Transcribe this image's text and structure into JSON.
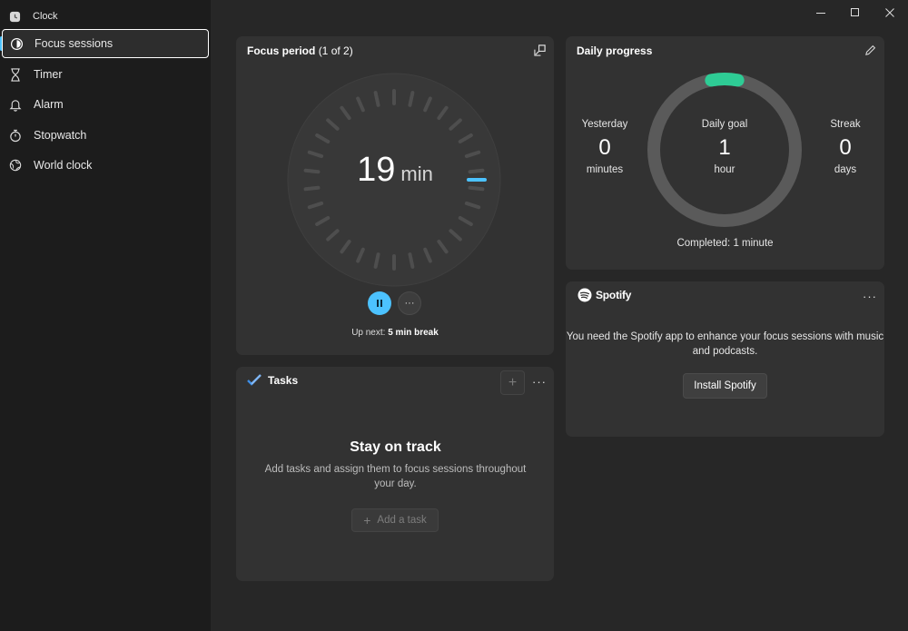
{
  "app": {
    "title": "Clock"
  },
  "sidebar": {
    "items": [
      {
        "label": "Focus sessions",
        "icon": "focus-icon",
        "active": true
      },
      {
        "label": "Timer",
        "icon": "hourglass-icon"
      },
      {
        "label": "Alarm",
        "icon": "bell-icon"
      },
      {
        "label": "Stopwatch",
        "icon": "stopwatch-icon"
      },
      {
        "label": "World clock",
        "icon": "globe-icon"
      }
    ]
  },
  "focus": {
    "title": "Focus period",
    "subtitle": "(1 of 2)",
    "time_value": "19",
    "time_unit": "min",
    "up_next_prefix": "Up next:",
    "up_next_value": "5 min break"
  },
  "tasks": {
    "title": "Tasks",
    "heading": "Stay on track",
    "description": "Add tasks and assign them to focus sessions throughout your day.",
    "add_label": "Add a task"
  },
  "daily": {
    "title": "Daily progress",
    "yesterday": {
      "label": "Yesterday",
      "value": "0",
      "unit": "minutes"
    },
    "goal": {
      "label": "Daily goal",
      "value": "1",
      "unit": "hour"
    },
    "streak": {
      "label": "Streak",
      "value": "0",
      "unit": "days"
    },
    "completed": "Completed: 1 minute",
    "progress_fraction": 0.017
  },
  "spotify": {
    "brand": "Spotify",
    "message": "You need the Spotify app to enhance your focus sessions with music and podcasts.",
    "button_label": "Install Spotify"
  },
  "colors": {
    "accent": "#4cc2ff",
    "progress": "#2ecc95",
    "background": "#272727",
    "card": "#323232",
    "sidebar": "#1c1c1c"
  }
}
